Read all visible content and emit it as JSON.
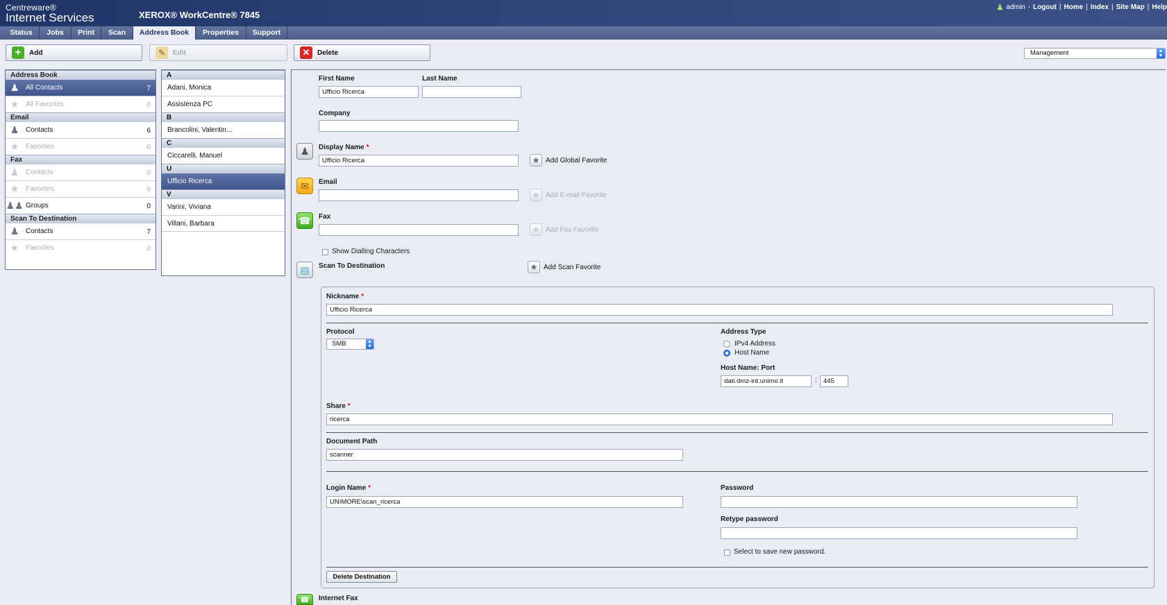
{
  "header": {
    "brand_line1": "Centreware®",
    "brand_line2": "Internet Services",
    "device": "XEROX® WorkCentre® 7845",
    "links": {
      "user": "admin",
      "dash": "-",
      "logout": "Logout",
      "home": "Home",
      "index": "Index",
      "sitemap": "Site Map",
      "help": "Help",
      "sep": "|"
    }
  },
  "tabs": [
    "Status",
    "Jobs",
    "Print",
    "Scan",
    "Address Book",
    "Properties",
    "Support"
  ],
  "toolbar": {
    "add": "Add",
    "edit": "Edit",
    "delete": "Delete",
    "view_select": "Management"
  },
  "left_panel": {
    "address_book": "Address Book",
    "all_contacts": "All Contacts",
    "all_contacts_count": "7",
    "all_favorites": "All Favorites",
    "all_favorites_count": "0",
    "email": "Email",
    "email_contacts": "Contacts",
    "email_contacts_count": "6",
    "email_favorites": "Favorites",
    "email_favorites_count": "0",
    "fax": "Fax",
    "fax_contacts": "Contacts",
    "fax_contacts_count": "0",
    "fax_favorites": "Favorites",
    "fax_favorites_count": "0",
    "groups": "Groups",
    "groups_count": "0",
    "scan_to_destination": "Scan To Destination",
    "scan_contacts": "Contacts",
    "scan_contacts_count": "7",
    "scan_favorites": "Favorites",
    "scan_favorites_count": "0"
  },
  "contacts": {
    "h_a": "A",
    "adani": "Adani, Monica",
    "assistenza": "Assistenza PC",
    "h_b": "B",
    "brancolini": "Brancolini, Valentin...",
    "h_c": "C",
    "ciccarelli": "Ciccarelli, Manuel",
    "h_u": "U",
    "ufficio": "Ufficio Ricerca",
    "h_v": "V",
    "varini": "Varini, Viviana",
    "villani": "Villani, Barbara"
  },
  "form": {
    "first_name_label": "First Name",
    "first_name": "Ufficio Ricerca",
    "last_name_label": "Last Name",
    "last_name": "",
    "company_label": "Company",
    "company": "",
    "display_name_label": "Display Name",
    "display_name": "Ufficio Ricerca",
    "required": "*",
    "add_global_favorite": "Add Global Favorite",
    "email_label": "Email",
    "email": "",
    "add_email_favorite": "Add E-mail Favorite",
    "fax_label": "Fax",
    "fax": "",
    "add_fax_favorite": "Add Fax Favorite",
    "show_dialling": "Show Dialling Characters",
    "scan_label": "Scan To Destination",
    "add_scan_favorite": "Add Scan Favorite",
    "internet_fax_label": "Internet Fax"
  },
  "scan": {
    "nickname_label": "Nickname",
    "nickname": "Ufficio Ricerca",
    "protocol_label": "Protocol",
    "protocol": "SMB",
    "address_type_label": "Address Type",
    "ipv4": "IPv4 Address",
    "host_name": "Host Name",
    "host_port_label": "Host Name: Port",
    "host": "dati.dmz-int.unimo.it",
    "colon": ":",
    "port": "445",
    "share_label": "Share",
    "share": "ricerca",
    "doc_path_label": "Document Path",
    "doc_path": "scanner",
    "login_label": "Login Name",
    "login": "UNIMORE\\scan_ricerca",
    "password_label": "Password",
    "password": "",
    "retype_label": "Retype password",
    "retype": "",
    "save_password": "Select to save new password.",
    "delete_destination": "Delete Destination"
  },
  "colors": {
    "header_blue": "#1f3566",
    "selected_row": "#4a5f96",
    "required_red": "#d01010"
  }
}
